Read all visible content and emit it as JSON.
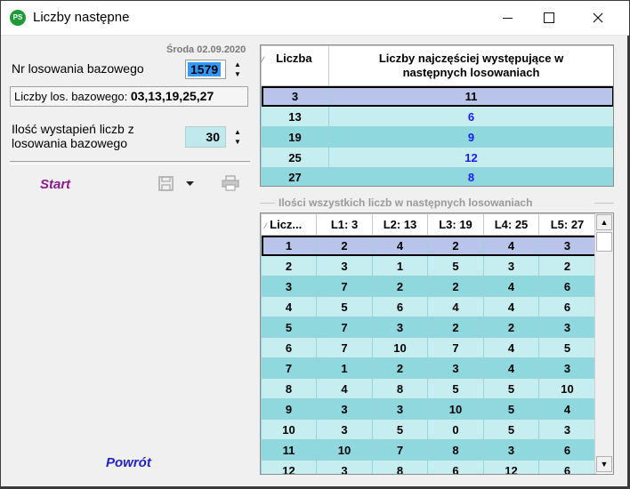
{
  "window": {
    "app_icon": "PS",
    "title": "Liczby następne"
  },
  "left": {
    "date": "Środa 02.09.2020",
    "nr_label": "Nr losowania bazowego",
    "nr_value": "1579",
    "numbers_label": "Liczby los. bazowego:",
    "numbers_value": "03,13,19,25,27",
    "count_label_1": "Ilość wystapień liczb z",
    "count_label_2": "losowania bazowego",
    "count_value": "30",
    "start_label": "Start",
    "back_label": "Powrót"
  },
  "top_table": {
    "headers": [
      "Liczba",
      "Liczby najczęściej występujące w następnych losowaniach"
    ],
    "rows": [
      [
        "3",
        "11"
      ],
      [
        "13",
        "6"
      ],
      [
        "19",
        "9"
      ],
      [
        "25",
        "12"
      ],
      [
        "27",
        "8"
      ]
    ]
  },
  "bottom_table": {
    "group_title": "Ilości wszystkich liczb w następnych losowaniach",
    "headers": [
      "Licz...",
      "L1: 3",
      "L2: 13",
      "L3: 19",
      "L4: 25",
      "L5: 27"
    ],
    "rows": [
      [
        "1",
        "2",
        "4",
        "2",
        "4",
        "3"
      ],
      [
        "2",
        "3",
        "1",
        "5",
        "3",
        "2"
      ],
      [
        "3",
        "7",
        "2",
        "2",
        "4",
        "6"
      ],
      [
        "4",
        "5",
        "6",
        "4",
        "4",
        "6"
      ],
      [
        "5",
        "7",
        "3",
        "2",
        "2",
        "3"
      ],
      [
        "6",
        "7",
        "10",
        "7",
        "4",
        "5"
      ],
      [
        "7",
        "1",
        "2",
        "3",
        "4",
        "3"
      ],
      [
        "8",
        "4",
        "8",
        "5",
        "5",
        "10"
      ],
      [
        "9",
        "3",
        "3",
        "10",
        "5",
        "4"
      ],
      [
        "10",
        "3",
        "5",
        "0",
        "5",
        "3"
      ],
      [
        "11",
        "10",
        "7",
        "8",
        "3",
        "6"
      ],
      [
        "12",
        "3",
        "8",
        "6",
        "12",
        "6"
      ]
    ]
  }
}
